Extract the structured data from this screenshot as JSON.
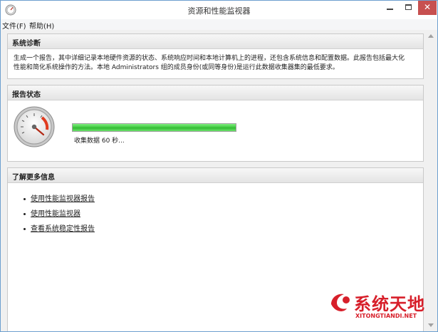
{
  "window": {
    "title": "资源和性能监视器",
    "close_glyph": "✕"
  },
  "menu": {
    "items": [
      "文件(F)",
      "帮助(H)"
    ]
  },
  "diagnostics": {
    "header": "系统诊断",
    "description_line1": "生成一个报告，其中详细记录本地硬件资源的状态、系统响应时间和本地计算机上的进程，还包含系统信息和配置数据。此报告包括最大化",
    "description_line2": "性能和简化系统操作的方法。本地 Administrators 组的成员身份(或同等身份)是运行此数据收集器集的最低要求。"
  },
  "report_status": {
    "header": "报告状态",
    "progress_fraction": 1.0,
    "status_text": "收集数据 60 秒...",
    "gauge_icon": "performance-gauge-icon"
  },
  "more_info": {
    "header": "了解更多信息",
    "links": [
      "使用性能监视器报告",
      "使用性能监视器",
      "查看系统稳定性报告"
    ]
  },
  "watermark": {
    "text": "系统天地",
    "url": "XITONGTIANDI.NET"
  },
  "colors": {
    "progress_green": "#3ec63e",
    "close_button": "#c75050",
    "watermark_red": "#d71f2a"
  }
}
